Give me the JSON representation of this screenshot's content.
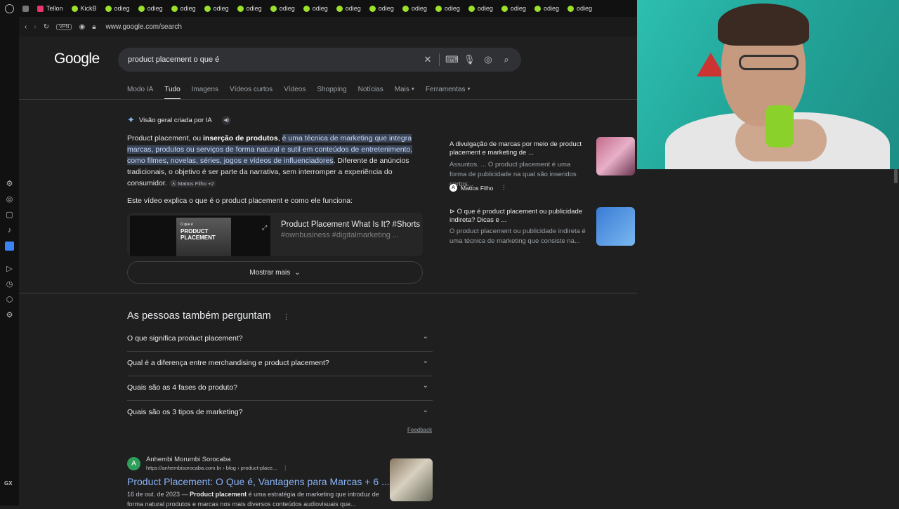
{
  "tabs": [
    {
      "label": "Tellon",
      "color": "pink"
    },
    {
      "label": "KickB",
      "color": "green"
    },
    {
      "label": "odieg",
      "color": "green"
    },
    {
      "label": "odieg",
      "color": "green"
    },
    {
      "label": "odieg",
      "color": "green"
    },
    {
      "label": "odieg",
      "color": "green"
    },
    {
      "label": "odieg",
      "color": "green"
    },
    {
      "label": "odieg",
      "color": "green"
    },
    {
      "label": "odieg",
      "color": "green"
    },
    {
      "label": "odieg",
      "color": "green"
    },
    {
      "label": "odieg",
      "color": "green"
    },
    {
      "label": "odieg",
      "color": "green"
    },
    {
      "label": "odieg",
      "color": "green"
    },
    {
      "label": "odieg",
      "color": "green"
    },
    {
      "label": "odieg",
      "color": "green"
    },
    {
      "label": "odieg",
      "color": "green"
    },
    {
      "label": "odieg",
      "color": "green"
    }
  ],
  "toolbar": {
    "vpn": "VPN",
    "url": "www.google.com/search"
  },
  "sidebar": {
    "gx": "GX"
  },
  "google": {
    "logo": "Google",
    "query": "product placement o que é",
    "nav": [
      "Modo IA",
      "Tudo",
      "Imagens",
      "Vídeos curtos",
      "Vídeos",
      "Shopping",
      "Notícias",
      "Mais",
      "Ferramentas"
    ],
    "active_nav": "Tudo"
  },
  "ai": {
    "heading": "Visão geral criada por IA",
    "p1_start": "Product placement, ou ",
    "p1_bold": "inserção de produtos",
    "p1_comma": ", ",
    "p1_highlight": "é uma técnica de marketing que integra marcas, produtos ou serviços de forma natural e sutil em conteúdos de entretenimento, como filmes, novelas, séries, jogos e vídeos de influenciadores",
    "p1_end": ". Diferente de anúncios tradicionais, o objetivo é ser parte da narrativa, sem interromper a experiência do consumidor.",
    "source_chip": "Mattos Filho +2",
    "video_intro": "Este vídeo explica o que é o product placement e como ele funciona:",
    "video_thumb_small": "O que é",
    "video_thumb_text": "PRODUCT PLACEMENT",
    "video_title": "Product Placement What Is It? #Shorts",
    "video_sub": "#ownbusiness #digitalmarketing ...",
    "show_more": "Mostrar mais"
  },
  "right_cards": [
    {
      "title": "A divulgação de marcas por meio de product placement e marketing de ...",
      "desc": "Assuntos. ... O product placement é uma forma de publicidade na qual são inseridos certos...",
      "source": "Mattos Filho",
      "img_color": "#c26b8a"
    },
    {
      "title": "⊳ O que é product placement ou publicidade indireta? Dicas e ...",
      "desc": "O product placement ou publicidade indireta é uma técnica de marketing que consiste na...",
      "img_color": "#3a7bd5"
    }
  ],
  "paa": {
    "title": "As pessoas também perguntam",
    "questions": [
      "O que significa product placement?",
      "Qual é a diferença entre merchandising e product placement?",
      "Quais são as 4 fases do produto?",
      "Quais são os 3 tipos de marketing?"
    ],
    "feedback": "Feedback"
  },
  "result": {
    "fav_letter": "A",
    "site": "Anhembi Morumbi Sorocaba",
    "url": "https://anhembisorocaba.com.br › blog › product-place...",
    "title": "Product Placement: O Que é, Vantagens para Marcas + 6 ...",
    "date": "16 de out. de 2023 — ",
    "bold": "Product placement",
    "snippet": " é uma estratégia de marketing que introduz de forma natural produtos e marcas nos mais diversos conteúdos audiovisuais que..."
  }
}
